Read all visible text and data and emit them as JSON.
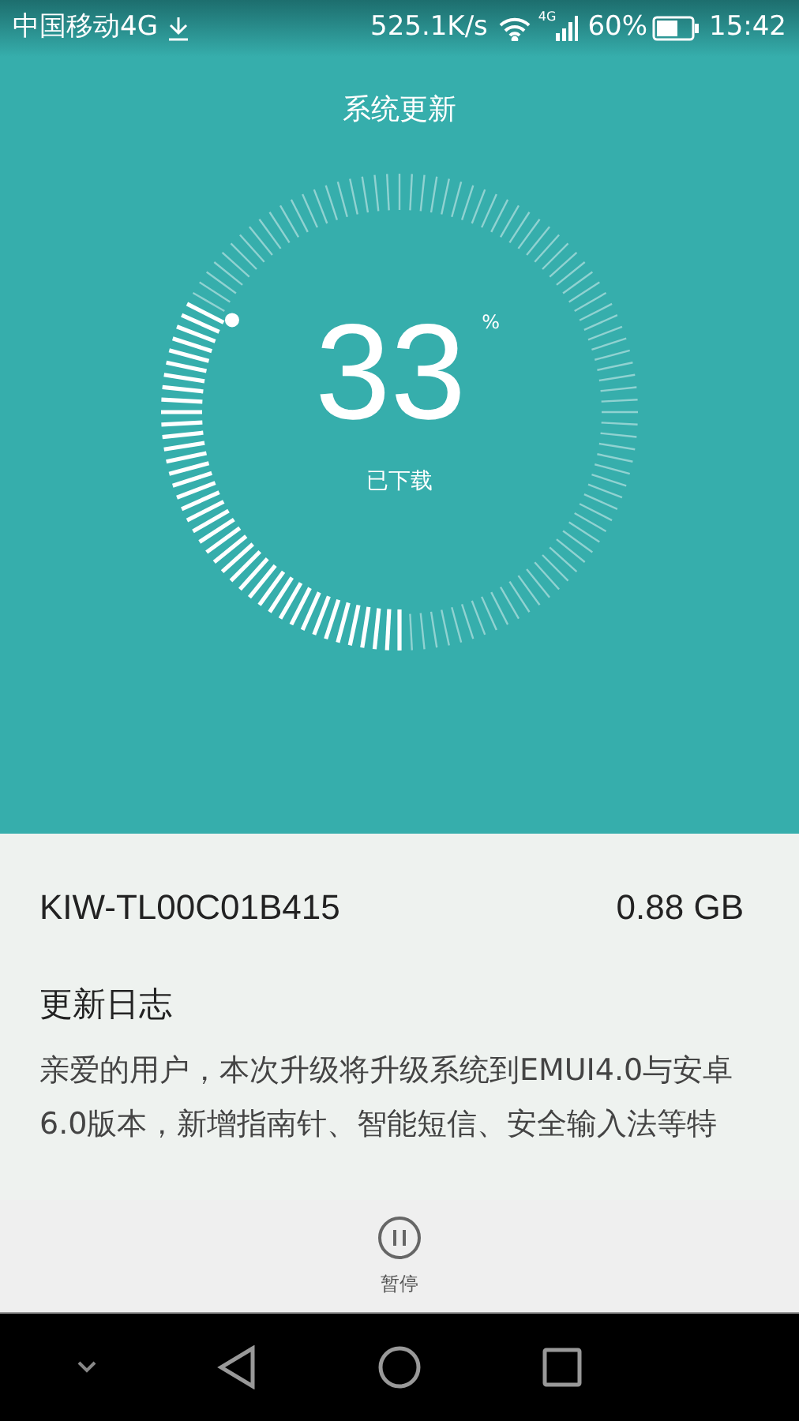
{
  "status_bar": {
    "carrier": "中国移动4G",
    "speed": "525.1K/s",
    "network": "4G",
    "battery": "60%",
    "time": "15:42"
  },
  "title": "系统更新",
  "download": {
    "percent": "33",
    "unit": "%",
    "label": "已下载"
  },
  "package": {
    "version": "KIW-TL00C01B415",
    "size": "0.88 GB"
  },
  "changelog": {
    "heading": "更新日志",
    "text": "亲爱的用户，本次升级将升级系统到EMUI4.0与安卓6.0版本，新增指南针、智能短信、安全输入法等特"
  },
  "action": {
    "label": "暂停"
  }
}
